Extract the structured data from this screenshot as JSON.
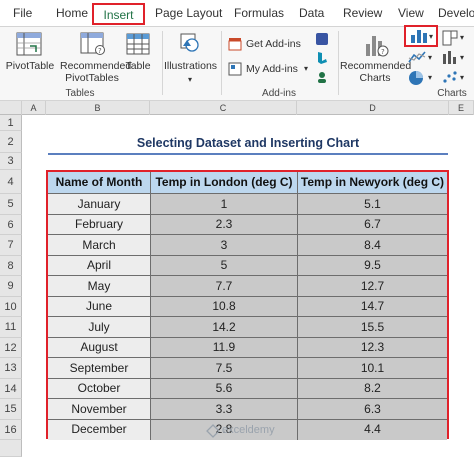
{
  "ribbon_tabs": [
    "File",
    "Home",
    "Insert",
    "Page Layout",
    "Formulas",
    "Data",
    "Review",
    "View",
    "Develo"
  ],
  "ribbon": {
    "pivottable": "PivotTable",
    "recommended_pivottables_1": "Recommended",
    "recommended_pivottables_2": "PivotTables",
    "table": "Table",
    "tables_group": "Tables",
    "illustrations": "Illustrations",
    "get_addins": "Get Add-ins",
    "my_addins": "My Add-ins",
    "addins_group": "Add-ins",
    "recommended_charts_1": "Recommended",
    "recommended_charts_2": "Charts",
    "charts_group": "Charts"
  },
  "sheet": {
    "col_headers": [
      "A",
      "B",
      "C",
      "D",
      "E"
    ],
    "row_numbers": [
      "1",
      "2",
      "3",
      "4",
      "5",
      "6",
      "7",
      "8",
      "9",
      "10",
      "11",
      "12",
      "13",
      "14",
      "15",
      "16"
    ],
    "title": "Selecting Dataset and Inserting Chart"
  },
  "table": {
    "headers": [
      "Name of Month",
      "Temp in London (deg C)",
      "Temp in Newyork (deg C)"
    ],
    "rows": [
      {
        "month": "January",
        "london": "1",
        "newyork": "5.1"
      },
      {
        "month": "February",
        "london": "2.3",
        "newyork": "6.7"
      },
      {
        "month": "March",
        "london": "3",
        "newyork": "8.4"
      },
      {
        "month": "April",
        "london": "5",
        "newyork": "9.5"
      },
      {
        "month": "May",
        "london": "7.7",
        "newyork": "12.7"
      },
      {
        "month": "June",
        "london": "10.8",
        "newyork": "14.7"
      },
      {
        "month": "July",
        "london": "14.2",
        "newyork": "15.5"
      },
      {
        "month": "August",
        "london": "11.9",
        "newyork": "12.3"
      },
      {
        "month": "September",
        "london": "7.5",
        "newyork": "10.1"
      },
      {
        "month": "October",
        "london": "5.6",
        "newyork": "8.2"
      },
      {
        "month": "November",
        "london": "3.3",
        "newyork": "6.3"
      },
      {
        "month": "December",
        "london": "2.8",
        "newyork": "4.4"
      }
    ]
  },
  "watermark": "exceldemy",
  "colors": {
    "highlight": "#e0212a",
    "header_fill": "#bdd7ee",
    "excel_green": "#217346",
    "title_color": "#1f3864"
  }
}
